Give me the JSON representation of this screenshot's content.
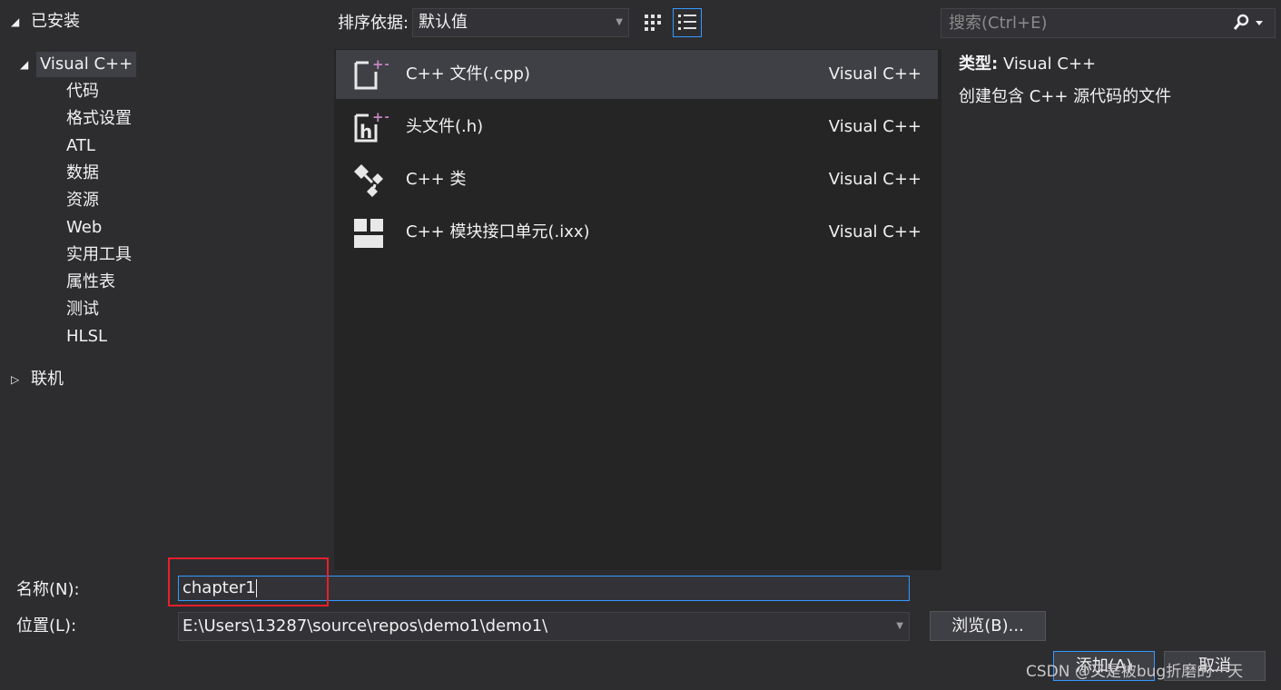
{
  "tree": {
    "installed": "已安装",
    "visual_cpp": "Visual C++",
    "children": [
      "代码",
      "格式设置",
      "ATL",
      "数据",
      "资源",
      "Web",
      "实用工具",
      "属性表",
      "测试",
      "HLSL"
    ],
    "online": "联机"
  },
  "toolbar": {
    "sort_label": "排序依据:",
    "sort_value": "默认值",
    "search_placeholder": "搜索(Ctrl+E)"
  },
  "templates": [
    {
      "name": "C++ 文件(.cpp)",
      "lang": "Visual C++",
      "icon": "cpp-file-icon"
    },
    {
      "name": "头文件(.h)",
      "lang": "Visual C++",
      "icon": "header-file-icon"
    },
    {
      "name": "C++ 类",
      "lang": "Visual C++",
      "icon": "class-icon"
    },
    {
      "name": "C++ 模块接口单元(.ixx)",
      "lang": "Visual C++",
      "icon": "module-icon"
    }
  ],
  "description": {
    "type_label": "类型:",
    "type_value": "Visual C++",
    "text": "创建包含 C++ 源代码的文件"
  },
  "form": {
    "name_label": "名称(N):",
    "name_value": "chapter1",
    "location_label": "位置(L):",
    "location_value": "E:\\Users\\13287\\source\\repos\\demo1\\demo1\\",
    "browse_label": "浏览(B)...",
    "add_label": "添加(A)",
    "cancel_label": "取消"
  },
  "watermark": "CSDN @又是被bug折磨的一天",
  "colors": {
    "accent": "#3399ff",
    "highlight": "#e8202a",
    "icon_plus": "#c586c0"
  }
}
